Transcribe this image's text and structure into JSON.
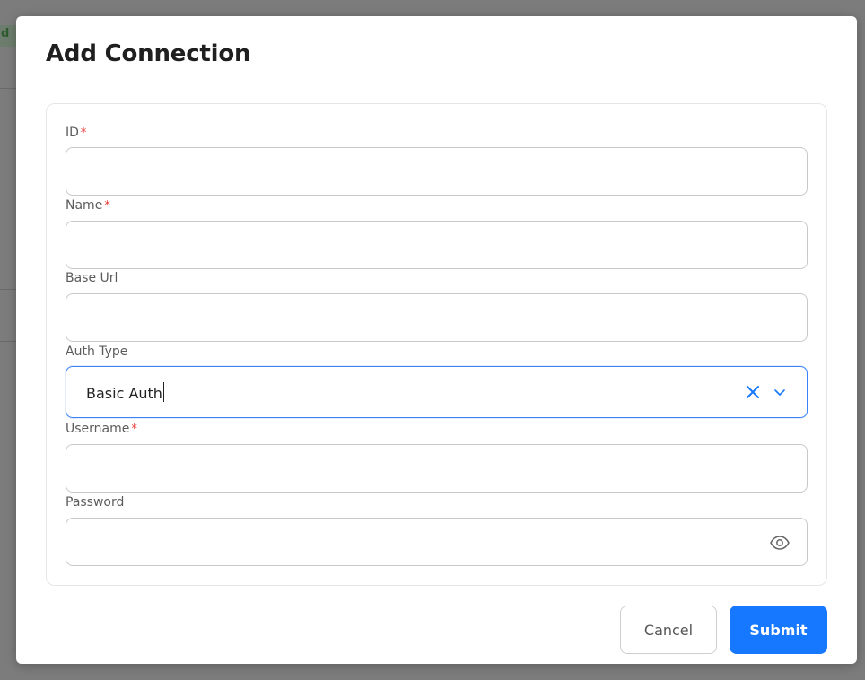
{
  "background": {
    "badge_text": "d"
  },
  "modal": {
    "title": "Add Connection",
    "fields": [
      {
        "label": "ID",
        "required": true,
        "value": ""
      },
      {
        "label": "Name",
        "required": true,
        "value": ""
      },
      {
        "label": "Base Url",
        "required": false,
        "value": ""
      },
      {
        "label": "Auth Type",
        "required": false,
        "value": "Basic Auth"
      },
      {
        "label": "Username",
        "required": true,
        "value": ""
      },
      {
        "label": "Password",
        "required": false,
        "value": ""
      }
    ],
    "required_marker": "*",
    "cancel_label": "Cancel",
    "submit_label": "Submit"
  },
  "colors": {
    "primary": "#1677ff",
    "focus_border": "#3b82f6",
    "required": "#e53935"
  },
  "icons": {
    "auth_type_clear": "close-icon",
    "auth_type_dropdown": "chevron-down-icon",
    "password_toggle": "eye-icon"
  }
}
